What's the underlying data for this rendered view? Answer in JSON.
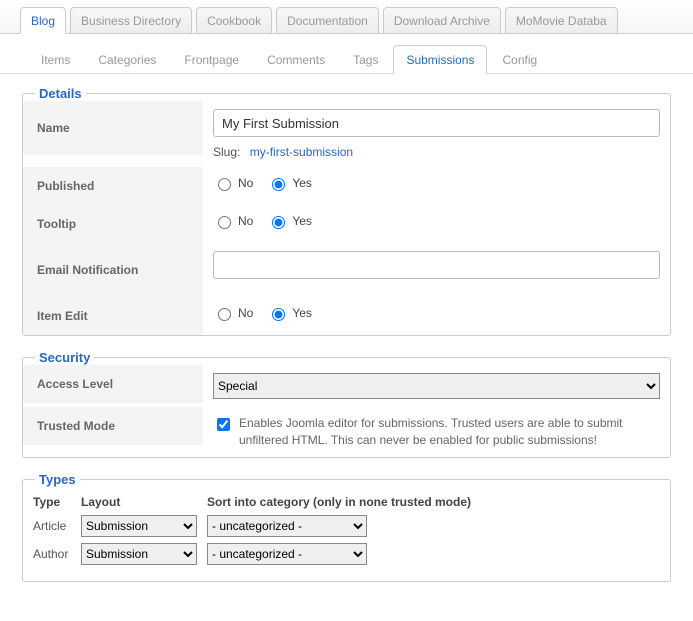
{
  "topTabs": [
    "Blog",
    "Business Directory",
    "Cookbook",
    "Documentation",
    "Download Archive",
    "MoMovie Databa"
  ],
  "subTabs": [
    "Items",
    "Categories",
    "Frontpage",
    "Comments",
    "Tags",
    "Submissions",
    "Config"
  ],
  "details": {
    "legend": "Details",
    "nameLabel": "Name",
    "nameValue": "My First Submission",
    "slugLabel": "Slug:",
    "slugValue": "my-first-submission",
    "publishedLabel": "Published",
    "tooltipLabel": "Tooltip",
    "emailLabel": "Email Notification",
    "emailValue": "",
    "itemEditLabel": "Item Edit",
    "noLabel": "No",
    "yesLabel": "Yes"
  },
  "security": {
    "legend": "Security",
    "accessLabel": "Access Level",
    "accessValue": "Special",
    "trustedLabel": "Trusted Mode",
    "trustedNote": "Enables Joomla editor for submissions. Trusted users are able to submit unfiltered HTML. This can never be enabled for public submissions!"
  },
  "types": {
    "legend": "Types",
    "headers": {
      "type": "Type",
      "layout": "Layout",
      "sort": "Sort into category (only in none trusted mode)"
    },
    "rows": [
      {
        "type": "Article",
        "layout": "Submission",
        "sort": "- uncategorized -"
      },
      {
        "type": "Author",
        "layout": "Submission",
        "sort": "- uncategorized -"
      }
    ]
  }
}
